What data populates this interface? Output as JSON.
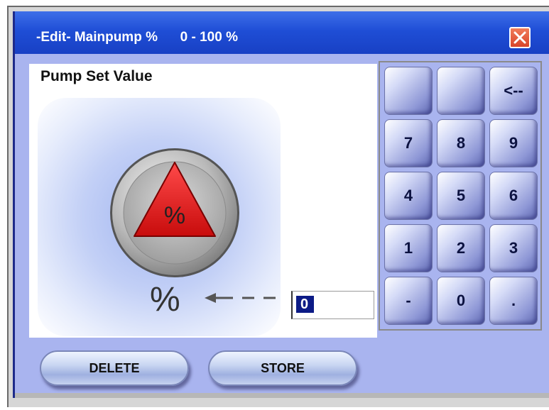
{
  "dialog": {
    "title": "-Edit- Mainpump %      0 - 100 %",
    "close_icon": "close-x-icon",
    "colors": {
      "titlebar": "#1f4ed6",
      "close": "#e0552f",
      "background": "#a9b4ef",
      "input_highlight": "#0c1b86"
    }
  },
  "panel": {
    "title": "Pump Set Value",
    "pump_icon": "percent-triangle-icon",
    "pump_icon_text": "%",
    "unit": "%",
    "arrow_icon": "dashed-arrow-left-icon",
    "value": "0"
  },
  "keypad": {
    "keys": [
      "",
      "",
      "<--",
      "7",
      "8",
      "9",
      "4",
      "5",
      "6",
      "1",
      "2",
      "3",
      "-",
      "0",
      "."
    ]
  },
  "buttons": {
    "delete_label": "DELETE",
    "store_label": "STORE"
  }
}
